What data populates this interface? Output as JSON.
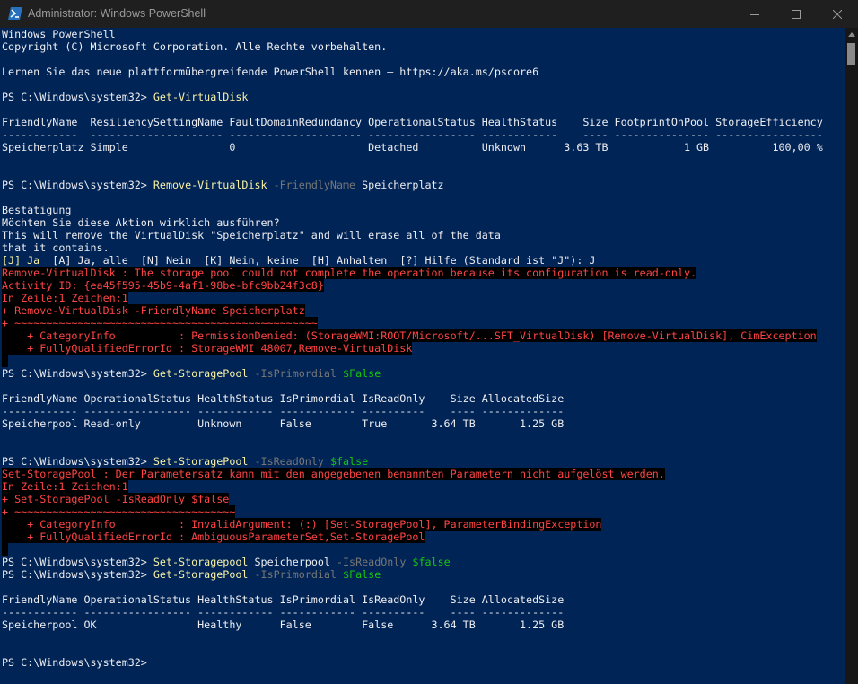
{
  "window": {
    "title": "Administrator: Windows PowerShell",
    "icon": "powershell-icon",
    "controls": [
      "minimize-icon",
      "maximize-icon",
      "close-icon"
    ]
  },
  "colors": {
    "background": "#012456",
    "text": "#cccccc",
    "command": "#f9f1a5",
    "parameter": "#767676",
    "variable": "#16c60c",
    "error": "#ff4444",
    "error_background": "#000000"
  },
  "lines": [
    [
      {
        "t": "Windows PowerShell",
        "c": "white"
      }
    ],
    [
      {
        "t": "Copyright (C) Microsoft Corporation. Alle Rechte vorbehalten.",
        "c": "white"
      }
    ],
    [],
    [
      {
        "t": "Lernen Sie das neue plattformübergreifende PowerShell kennen – https://aka.ms/pscore6",
        "c": "white"
      }
    ],
    [],
    [
      {
        "t": "PS C:\\Windows\\system32> ",
        "c": "prompt"
      },
      {
        "t": "Get-VirtualDisk",
        "c": "yellow"
      }
    ],
    [],
    [
      {
        "t": "FriendlyName  ResiliencySettingName FaultDomainRedundancy OperationalStatus HealthStatus    Size FootprintOnPool StorageEfficiency",
        "c": "white"
      }
    ],
    [
      {
        "t": "------------  --------------------- --------------------- ----------------- ------------    ---- --------------- -----------------",
        "c": "white"
      }
    ],
    [
      {
        "t": "Speicherplatz Simple                0                     Detached          Unknown      3.63 TB            1 GB          100,00 %",
        "c": "white"
      }
    ],
    [],
    [],
    [
      {
        "t": "PS C:\\Windows\\system32> ",
        "c": "prompt"
      },
      {
        "t": "Remove-VirtualDisk",
        "c": "yellow"
      },
      {
        "t": " -FriendlyName",
        "c": "gray"
      },
      {
        "t": " Speicherplatz",
        "c": "white"
      }
    ],
    [],
    [
      {
        "t": "Bestätigung",
        "c": "white"
      }
    ],
    [
      {
        "t": "Möchten Sie diese Aktion wirklich ausführen?",
        "c": "white"
      }
    ],
    [
      {
        "t": "This will remove the VirtualDisk \"Speicherplatz\" and will erase all of the data",
        "c": "white"
      }
    ],
    [
      {
        "t": "that it contains.",
        "c": "white"
      }
    ],
    [
      {
        "t": "[J] Ja",
        "c": "yellow"
      },
      {
        "t": "  [A] Ja, alle  [N] Nein  [K] Nein, keine  [H] Anhalten  [?] Hilfe (Standard ist \"J\"): J",
        "c": "white"
      }
    ],
    [
      {
        "t": "Remove-VirtualDisk : The storage pool could not complete the operation because its configuration is read-only.",
        "c": "err"
      }
    ],
    [
      {
        "t": "Activity ID: {ea45f595-45b9-4af1-98be-bfc9bb24f3c8}",
        "c": "err"
      }
    ],
    [
      {
        "t": "In Zeile:1 Zeichen:1",
        "c": "err"
      }
    ],
    [
      {
        "t": "+ Remove-VirtualDisk -FriendlyName Speicherplatz",
        "c": "err"
      }
    ],
    [
      {
        "t": "+ ~~~~~~~~~~~~~~~~~~~~~~~~~~~~~~~~~~~~~~~~~~~~~~~~",
        "c": "err"
      }
    ],
    [
      {
        "t": "    + CategoryInfo          : PermissionDenied: (StorageWMI:ROOT/Microsoft/...SFT_VirtualDisk) [Remove-VirtualDisk], CimException",
        "c": "err"
      }
    ],
    [
      {
        "t": "    + FullyQualifiedErrorId : StorageWMI 48007,Remove-VirtualDisk",
        "c": "err"
      }
    ],
    [
      {
        "t": " ",
        "c": "err"
      }
    ],
    [
      {
        "t": "PS C:\\Windows\\system32> ",
        "c": "prompt"
      },
      {
        "t": "Get-StoragePool",
        "c": "yellow"
      },
      {
        "t": " -IsPrimordial",
        "c": "gray"
      },
      {
        "t": " $False",
        "c": "green"
      }
    ],
    [],
    [
      {
        "t": "FriendlyName OperationalStatus HealthStatus IsPrimordial IsReadOnly    Size AllocatedSize",
        "c": "white"
      }
    ],
    [
      {
        "t": "------------ ----------------- ------------ ------------ ----------    ---- -------------",
        "c": "white"
      }
    ],
    [
      {
        "t": "Speicherpool Read-only         Unknown      False        True       3.64 TB       1.25 GB",
        "c": "white"
      }
    ],
    [],
    [],
    [
      {
        "t": "PS C:\\Windows\\system32> ",
        "c": "prompt"
      },
      {
        "t": "Set-StoragePool",
        "c": "yellow"
      },
      {
        "t": " -IsReadOnly",
        "c": "gray"
      },
      {
        "t": " $false",
        "c": "green"
      }
    ],
    [
      {
        "t": "Set-StoragePool : Der Parametersatz kann mit den angegebenen benannten Parametern nicht aufgelöst werden.",
        "c": "err"
      }
    ],
    [
      {
        "t": "In Zeile:1 Zeichen:1",
        "c": "err"
      }
    ],
    [
      {
        "t": "+ Set-StoragePool -IsReadOnly $false",
        "c": "err"
      }
    ],
    [
      {
        "t": "+ ~~~~~~~~~~~~~~~~~~~~~~~~~~~~~~~~~~~",
        "c": "err"
      }
    ],
    [
      {
        "t": "    + CategoryInfo          : InvalidArgument: (:) [Set-StoragePool], ParameterBindingException",
        "c": "err"
      }
    ],
    [
      {
        "t": "    + FullyQualifiedErrorId : AmbiguousParameterSet,Set-StoragePool",
        "c": "err"
      }
    ],
    [
      {
        "t": " ",
        "c": "err"
      }
    ],
    [
      {
        "t": "PS C:\\Windows\\system32> ",
        "c": "prompt"
      },
      {
        "t": "Set-Storagepool",
        "c": "yellow"
      },
      {
        "t": " Speicherpool",
        "c": "white"
      },
      {
        "t": " -IsReadOnly",
        "c": "gray"
      },
      {
        "t": " $false",
        "c": "green"
      }
    ],
    [
      {
        "t": "PS C:\\Windows\\system32> ",
        "c": "prompt"
      },
      {
        "t": "Get-StoragePool",
        "c": "yellow"
      },
      {
        "t": " -IsPrimordial",
        "c": "gray"
      },
      {
        "t": " $False",
        "c": "green"
      }
    ],
    [],
    [
      {
        "t": "FriendlyName OperationalStatus HealthStatus IsPrimordial IsReadOnly    Size AllocatedSize",
        "c": "white"
      }
    ],
    [
      {
        "t": "------------ ----------------- ------------ ------------ ----------    ---- -------------",
        "c": "white"
      }
    ],
    [
      {
        "t": "Speicherpool OK                Healthy      False        False      3.64 TB       1.25 GB",
        "c": "white"
      }
    ],
    [],
    [],
    [
      {
        "t": "PS C:\\Windows\\system32>",
        "c": "prompt"
      }
    ]
  ]
}
